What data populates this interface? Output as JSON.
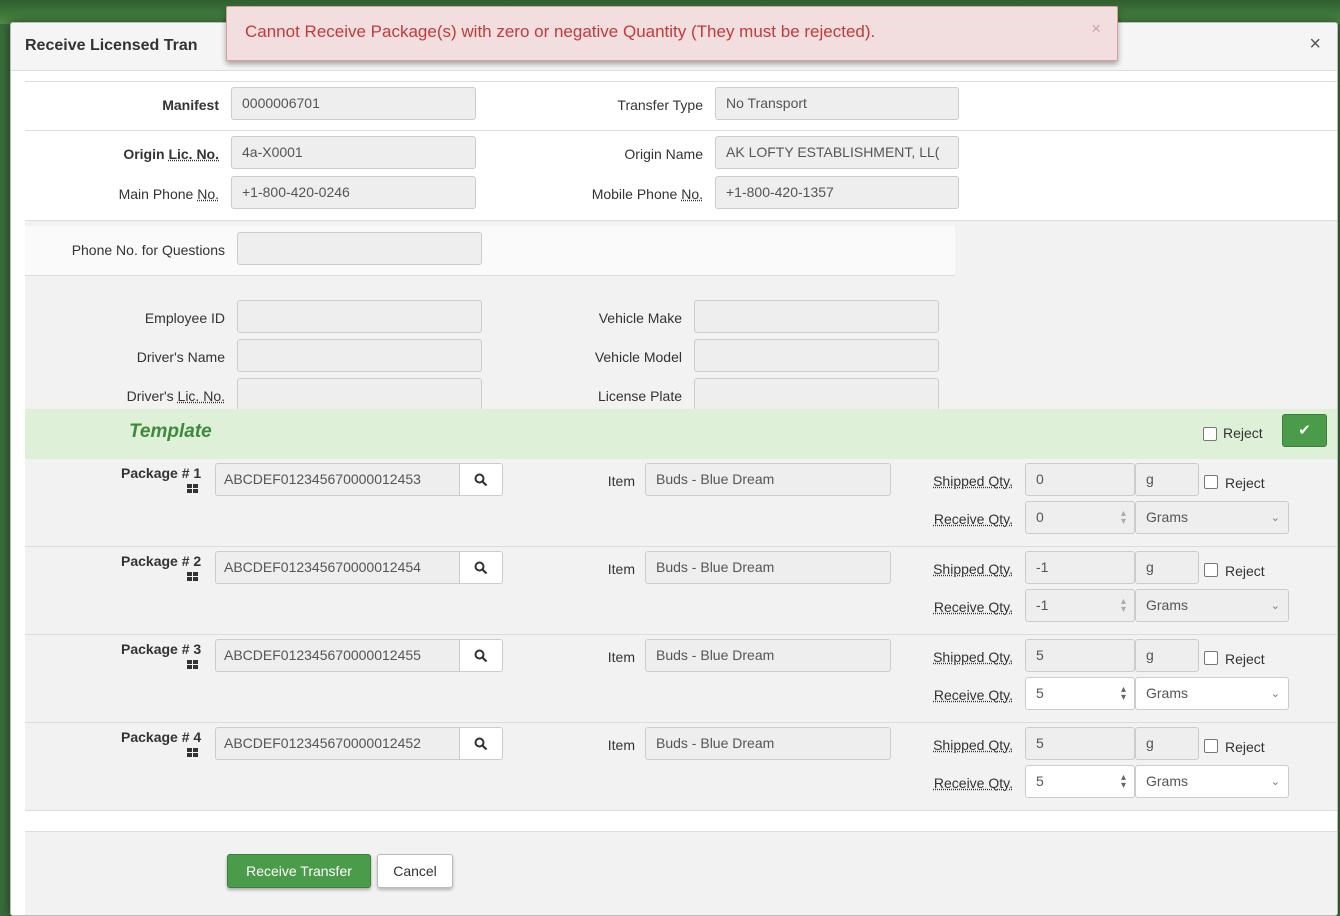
{
  "toast": {
    "message": "Cannot Receive Package(s) with zero or negative Quantity (They must be rejected).",
    "close": "×"
  },
  "modal": {
    "title": "Receive Licensed Tran",
    "close": "×"
  },
  "manifest": {
    "manifest_label": "Manifest",
    "manifest_value": "0000006701",
    "transfer_type_label": "Transfer Type",
    "transfer_type_value": "No Transport"
  },
  "origin": {
    "lic_label_a": "Origin ",
    "lic_label_b": "Lic. No.",
    "lic_value": "4a-X0001",
    "name_label": "Origin Name",
    "name_value": "AK LOFTY ESTABLISHMENT, LL(",
    "main_phone_label_a": "Main Phone ",
    "main_phone_label_b": "No.",
    "main_phone_value": "+1-800-420-0246",
    "mobile_phone_label_a": "Mobile Phone ",
    "mobile_phone_label_b": "No.",
    "mobile_phone_value": "+1-800-420-1357"
  },
  "driver": {
    "phone_questions_label": "Phone No. for Questions",
    "employee_id_label": "Employee ID",
    "drivers_name_label": "Driver's Name",
    "drivers_lic_label_a": "Driver's ",
    "drivers_lic_label_b": "Lic. No.",
    "vehicle_make_label": "Vehicle Make",
    "vehicle_model_label": "Vehicle Model",
    "license_plate_label": "License Plate"
  },
  "template": {
    "title": "Template",
    "reject_label": "Reject",
    "ok_icon": "✔"
  },
  "packages": [
    {
      "label": "Package # 1",
      "tag": "ABCDEF012345670000012453",
      "item_label": "Item",
      "item": "Buds - Blue Dream",
      "shipped_label": "Shipped Qty.",
      "shipped": "0",
      "shipped_unit": "g",
      "reject_label": "Reject",
      "receive_label": "Receive Qty.",
      "receive": "0",
      "receive_unit": "Grams"
    },
    {
      "label": "Package # 2",
      "tag": "ABCDEF012345670000012454",
      "item_label": "Item",
      "item": "Buds - Blue Dream",
      "shipped_label": "Shipped Qty.",
      "shipped": "-1",
      "shipped_unit": "g",
      "reject_label": "Reject",
      "receive_label": "Receive Qty.",
      "receive": "-1",
      "receive_unit": "Grams"
    },
    {
      "label": "Package # 3",
      "tag": "ABCDEF012345670000012455",
      "item_label": "Item",
      "item": "Buds - Blue Dream",
      "shipped_label": "Shipped Qty.",
      "shipped": "5",
      "shipped_unit": "g",
      "reject_label": "Reject",
      "receive_label": "Receive Qty.",
      "receive": "5",
      "receive_unit": "Grams"
    },
    {
      "label": "Package # 4",
      "tag": "ABCDEF012345670000012452",
      "item_label": "Item",
      "item": "Buds - Blue Dream",
      "shipped_label": "Shipped Qty.",
      "shipped": "5",
      "shipped_unit": "g",
      "reject_label": "Reject",
      "receive_label": "Receive Qty.",
      "receive": "5",
      "receive_unit": "Grams"
    }
  ],
  "footer": {
    "receive_button": "Receive Transfer",
    "cancel_button": "Cancel"
  },
  "colors": {
    "accent_green": "#4a9b4a",
    "template_bg": "#dff0d8",
    "error_text": "#c23a3a",
    "error_bg": "#f2dede"
  }
}
